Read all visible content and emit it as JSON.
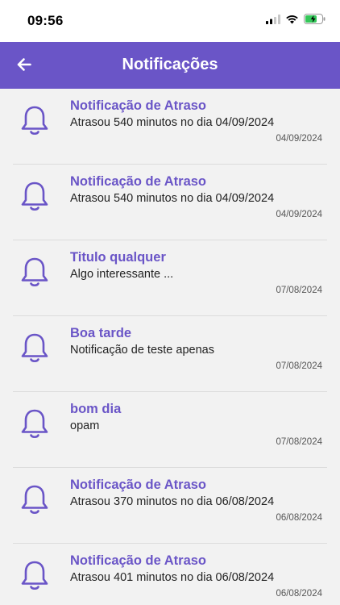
{
  "status_bar": {
    "time": "09:56",
    "icons": [
      "cellular-signal-icon",
      "wifi-icon",
      "battery-charging-icon"
    ]
  },
  "header": {
    "title": "Notificações",
    "back_icon": "arrow-left-icon"
  },
  "colors": {
    "accent": "#6a55c7",
    "background": "#f2f2f2",
    "battery": "#34c759"
  },
  "notifications": [
    {
      "title": "Notificação de Atraso",
      "body": "Atrasou 540 minutos no dia 04/09/2024",
      "date": "04/09/2024",
      "icon": "bell-icon"
    },
    {
      "title": "Notificação de Atraso",
      "body": "Atrasou 540 minutos no dia 04/09/2024",
      "date": "04/09/2024",
      "icon": "bell-icon"
    },
    {
      "title": "Titulo qualquer",
      "body": "Algo interessante ...",
      "date": "07/08/2024",
      "icon": "bell-icon"
    },
    {
      "title": "Boa tarde",
      "body": "Notificação de teste apenas",
      "date": "07/08/2024",
      "icon": "bell-icon"
    },
    {
      "title": "bom dia",
      "body": "opam",
      "date": "07/08/2024",
      "icon": "bell-icon"
    },
    {
      "title": "Notificação de Atraso",
      "body": "Atrasou 370 minutos no dia 06/08/2024",
      "date": "06/08/2024",
      "icon": "bell-icon"
    },
    {
      "title": "Notificação de Atraso",
      "body": "Atrasou 401 minutos no dia 06/08/2024",
      "date": "06/08/2024",
      "icon": "bell-icon"
    }
  ]
}
